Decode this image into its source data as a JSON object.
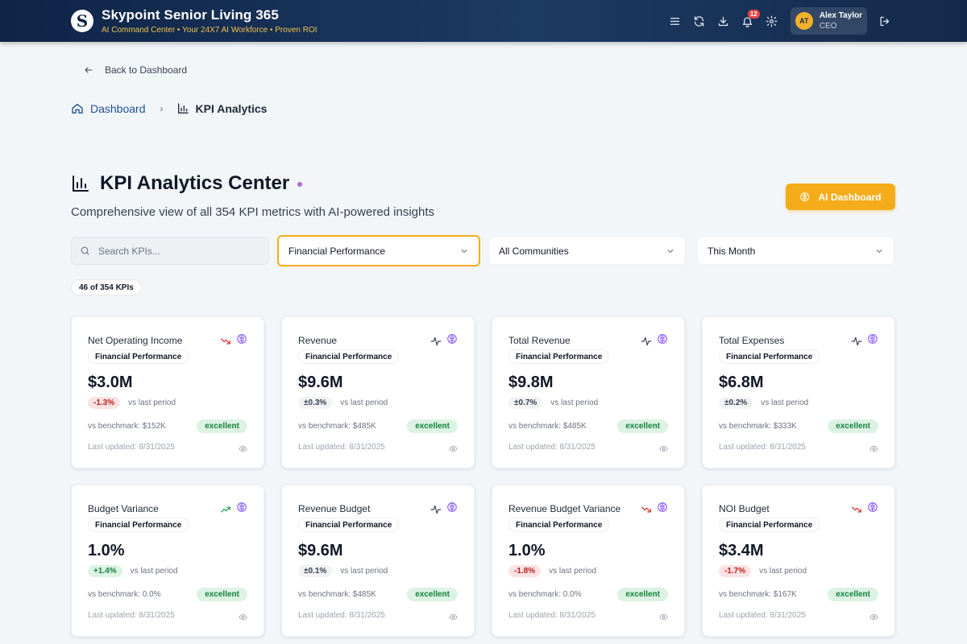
{
  "header": {
    "logo_letter": "S",
    "title": "Skypoint Senior Living 365",
    "subtitle": "AI Command Center • Your 24X7 AI Workforce • Proven ROI",
    "notification_count": "12",
    "user": {
      "initials": "AT",
      "name": "Alex Taylor",
      "role": "CEO"
    },
    "icons": [
      "menu-icon",
      "refresh-icon",
      "download-icon",
      "bell-icon",
      "gear-icon",
      "logout-icon"
    ]
  },
  "nav": {
    "back_label": "Back to Dashboard",
    "breadcrumb": {
      "home": "Dashboard",
      "current": "KPI Analytics"
    }
  },
  "page": {
    "title": "KPI Analytics Center",
    "subtitle": "Comprehensive view of all 354 KPI metrics with AI-powered insights",
    "ai_button": "AI Dashboard"
  },
  "filters": {
    "search_placeholder": "Search KPIs...",
    "category": "Financial Performance",
    "community": "All Communities",
    "period": "This Month",
    "count_label": "46 of 354 KPIs"
  },
  "colors": {
    "accent": "#f4ac1b",
    "header": "#0f2447",
    "negative": "#dc2626",
    "positive": "#16a34a",
    "brain": "#8b5cf6"
  },
  "cards": [
    {
      "name": "Net Operating Income",
      "category": "Financial Performance",
      "value": "$3.0M",
      "change": "-1.3%",
      "change_type": "neg",
      "trend_icon": "trend-down-icon",
      "vs_label": "vs last period",
      "benchmark": "vs benchmark: $152K",
      "status": "excellent",
      "updated": "Last updated: 8/31/2025"
    },
    {
      "name": "Revenue",
      "category": "Financial Performance",
      "value": "$9.6M",
      "change": "±0.3%",
      "change_type": "neu",
      "trend_icon": "activity-icon",
      "vs_label": "vs last period",
      "benchmark": "vs benchmark: $485K",
      "status": "excellent",
      "updated": "Last updated: 8/31/2025"
    },
    {
      "name": "Total Revenue",
      "category": "Financial Performance",
      "value": "$9.8M",
      "change": "±0.7%",
      "change_type": "neu",
      "trend_icon": "activity-icon",
      "vs_label": "vs last period",
      "benchmark": "vs benchmark: $485K",
      "status": "excellent",
      "updated": "Last updated: 8/31/2025"
    },
    {
      "name": "Total Expenses",
      "category": "Financial Performance",
      "value": "$6.8M",
      "change": "±0.2%",
      "change_type": "neu",
      "trend_icon": "activity-icon",
      "vs_label": "vs last period",
      "benchmark": "vs benchmark: $333K",
      "status": "excellent",
      "updated": "Last updated: 8/31/2025"
    },
    {
      "name": "Budget Variance",
      "category": "Financial Performance",
      "value": "1.0%",
      "change": "+1.4%",
      "change_type": "pos",
      "trend_icon": "trend-up-icon",
      "vs_label": "vs last period",
      "benchmark": "vs benchmark: 0.0%",
      "status": "excellent",
      "updated": "Last updated: 8/31/2025"
    },
    {
      "name": "Revenue Budget",
      "category": "Financial Performance",
      "value": "$9.6M",
      "change": "±0.1%",
      "change_type": "neu",
      "trend_icon": "activity-icon",
      "vs_label": "vs last period",
      "benchmark": "vs benchmark: $485K",
      "status": "excellent",
      "updated": "Last updated: 8/31/2025"
    },
    {
      "name": "Revenue Budget Variance",
      "category": "Financial Performance",
      "value": "1.0%",
      "change": "-1.8%",
      "change_type": "neg",
      "trend_icon": "trend-down-icon",
      "vs_label": "vs last period",
      "benchmark": "vs benchmark: 0.0%",
      "status": "excellent",
      "updated": "Last updated: 8/31/2025"
    },
    {
      "name": "NOI Budget",
      "category": "Financial Performance",
      "value": "$3.4M",
      "change": "-1.7%",
      "change_type": "neg",
      "trend_icon": "trend-down-icon",
      "vs_label": "vs last period",
      "benchmark": "vs benchmark: $167K",
      "status": "excellent",
      "updated": "Last updated: 8/31/2025"
    }
  ]
}
